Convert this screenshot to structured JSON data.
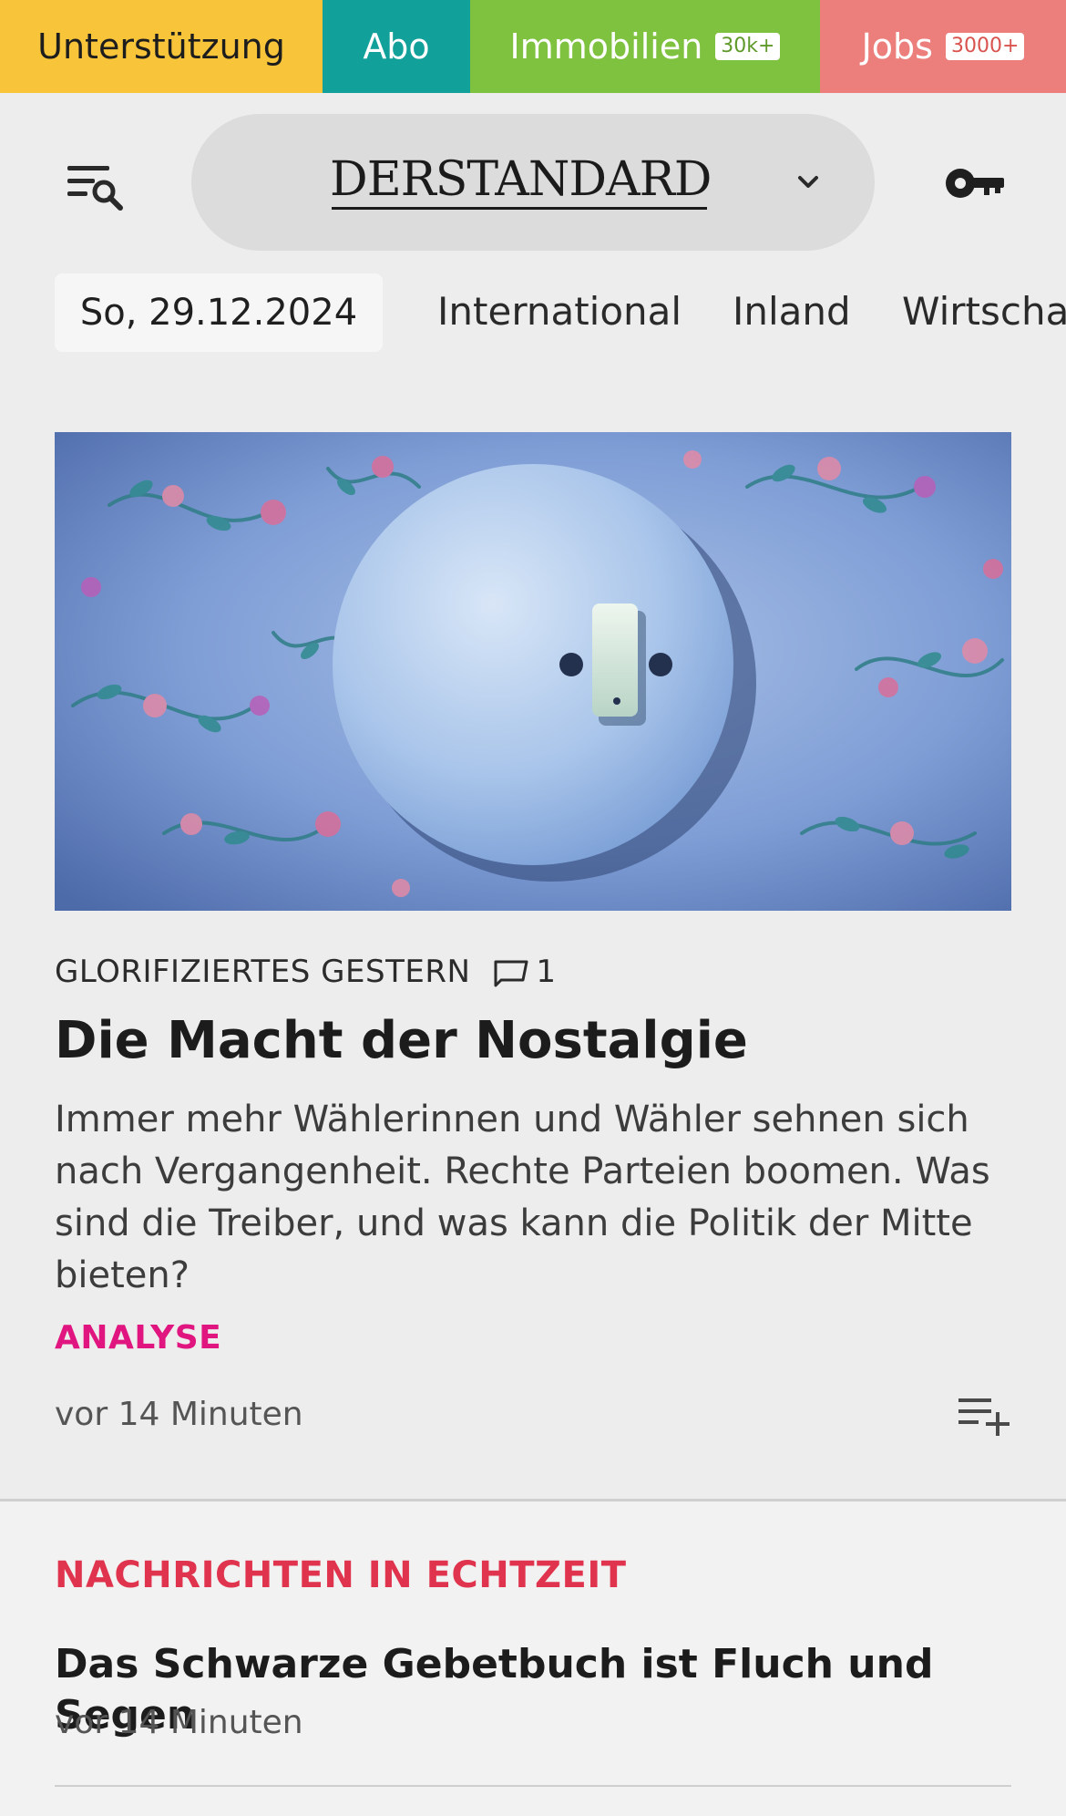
{
  "topbar": {
    "support": "Unterstützung",
    "abo": "Abo",
    "immobilien": "Immobilien",
    "immobilien_badge": "30k+",
    "jobs": "Jobs",
    "jobs_badge": "3000+"
  },
  "header": {
    "logo": "DERSTANDARD",
    "menu_icon": "menu-search-icon",
    "logo_menu_icon": "chevron-down-icon",
    "login_icon": "key-icon"
  },
  "nav": {
    "date": "So, 29.12.2024",
    "items": [
      "International",
      "Inland",
      "Wirtscha"
    ]
  },
  "article": {
    "kicker": "GLORIFIZIERTES GESTERN",
    "comments": "1",
    "headline": "Die Macht der Nostalgie",
    "teaser": "Immer mehr Wählerinnen und Wähler sehnen sich nach Vergangenheit. Rechte Parteien boomen. Was sind die Treiber, und was kann die Politik der Mitte bieten?",
    "label": "ANALYSE",
    "time": "vor 14 Minuten"
  },
  "live": {
    "section_title": "NACHRICHTEN IN ECHTZEIT",
    "title": "Das Schwarze Gebetbuch ist Fluch und Segen",
    "time": "vor 14 Minuten"
  },
  "colors": {
    "support": "#f8c53a",
    "abo": "#12a09a",
    "immobilien": "#7fc23f",
    "jobs": "#ec7f7c",
    "analyse": "#e0157f",
    "live_title": "#e0334d"
  }
}
